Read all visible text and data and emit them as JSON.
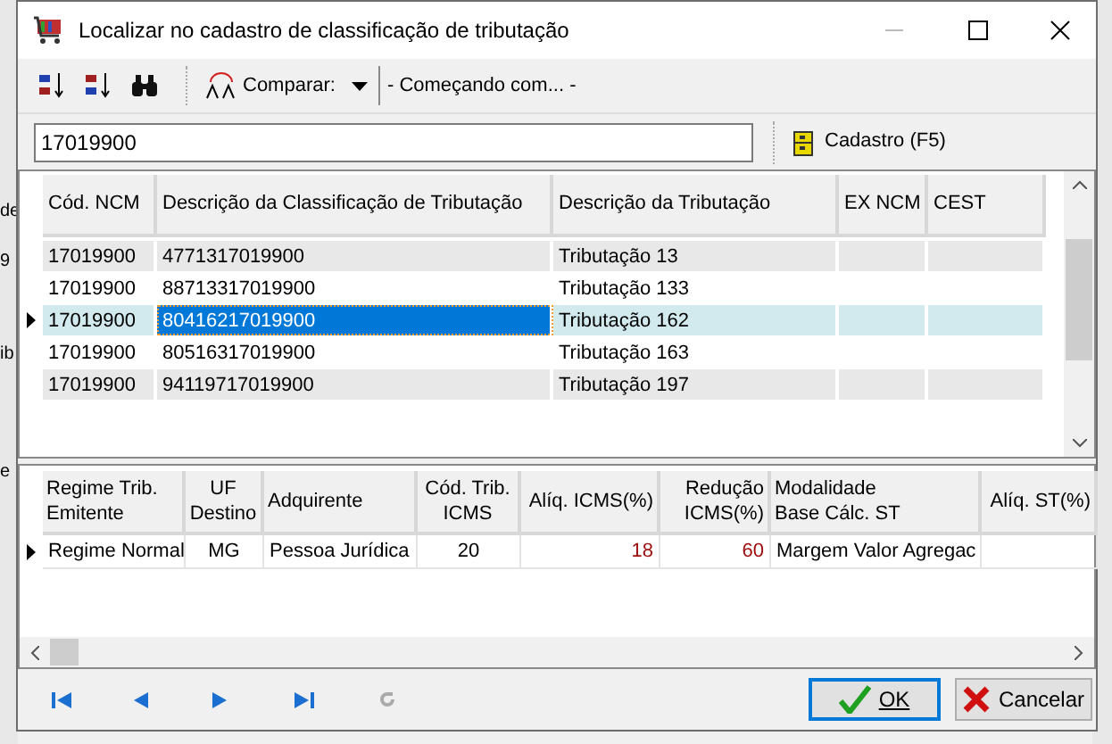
{
  "background_fragments": [
    "de",
    "9",
    "ib",
    "e"
  ],
  "window": {
    "title": "Localizar no cadastro de classificação de tributação"
  },
  "toolbar": {
    "compare_label": "Comparar:",
    "compare_mode": "- Começando com... -"
  },
  "search": {
    "value": "17019900"
  },
  "cadastro_button": {
    "label": "Cadastro (F5)"
  },
  "table": {
    "columns": [
      "Cód. NCM",
      "Descrição da Classificação de Tributação",
      "Descrição da Tributação",
      "EX NCM",
      "CEST"
    ],
    "rows": [
      {
        "cells": [
          "17019900",
          "4771317019900",
          "Tributação 13",
          "",
          ""
        ],
        "selected": false
      },
      {
        "cells": [
          "17019900",
          "88713317019900",
          "Tributação 133",
          "",
          ""
        ],
        "selected": false
      },
      {
        "cells": [
          "17019900",
          "80416217019900",
          "Tributação 162",
          "",
          ""
        ],
        "selected": true
      },
      {
        "cells": [
          "17019900",
          "80516317019900",
          "Tributação 163",
          "",
          ""
        ],
        "selected": false
      },
      {
        "cells": [
          "17019900",
          "94119717019900",
          "Tributação 197",
          "",
          ""
        ],
        "selected": false
      }
    ]
  },
  "detail_table": {
    "columns": [
      "Regime Trib.\nEmitente",
      "UF\nDestino",
      "Adquirente",
      "Cód. Trib.\nICMS",
      "Alíq. ICMS(%)",
      "Redução\nICMS(%)",
      "Modalidade\nBase Cálc. ST",
      "Alíq. ST(%)"
    ],
    "rows": [
      {
        "cells": [
          "Regime Normal",
          "MG",
          "Pessoa Jurídica",
          "20",
          "18",
          "60",
          "Margem Valor Agregac",
          ""
        ],
        "selected": true
      }
    ]
  },
  "buttons": [
    {
      "label": "OK",
      "kind": "ok"
    },
    {
      "label": "Cancelar",
      "kind": "cancel"
    }
  ]
}
